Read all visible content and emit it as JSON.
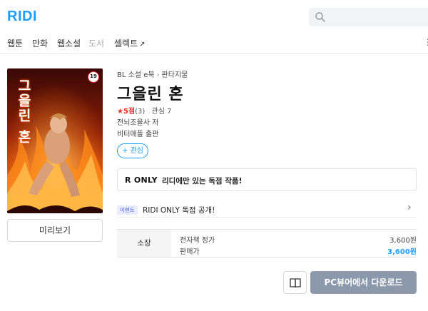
{
  "header": {
    "logo": "RIDI",
    "search": {
      "placeholder": ""
    }
  },
  "nav": {
    "items": [
      {
        "label": "웹툰"
      },
      {
        "label": "만화"
      },
      {
        "label": "웹소설"
      },
      {
        "label": "도서"
      },
      {
        "label": "셀렉트"
      }
    ],
    "more": "⋮"
  },
  "cover": {
    "age_rating": "19",
    "title_art": "그을린 혼"
  },
  "preview": {
    "label": "미리보기"
  },
  "book": {
    "breadcrumb": [
      "BL 소설 e북",
      "판타지물"
    ],
    "title": "그을린 혼",
    "rating_star": "★",
    "rating_score": "5점",
    "rating_count": "(3)",
    "interest_count": "관심 7",
    "author": "전뇌조율사 저",
    "publisher": "비터애플 출판",
    "interest_button": "+ 관심"
  },
  "ridi_only": {
    "logo": "R ONLY",
    "text": "리디에만 있는 독점 작품!"
  },
  "event": {
    "tag": "이벤트",
    "text": "RIDI ONLY 독점 공개!"
  },
  "price": {
    "label": "소장",
    "ebook_label": "전자책 정가",
    "ebook_value": "3,600원",
    "sale_label": "판매가",
    "sale_value": "3,600원"
  },
  "actions": {
    "download": "PC뷰어에서 다운로드"
  },
  "colors": {
    "brand": "#1e9eff",
    "rating": "#e8332b",
    "download_button": "#8c98ab"
  }
}
